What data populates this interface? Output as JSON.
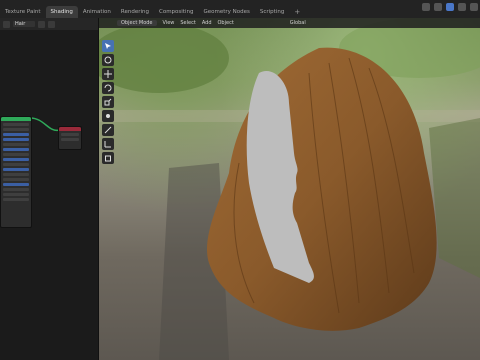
{
  "topbar": {
    "tabs": [
      "Texture Paint",
      "Shading",
      "Animation",
      "Rendering",
      "Compositing",
      "Geometry Nodes",
      "Scripting",
      "+"
    ],
    "active_tab": "Shading"
  },
  "left_panel": {
    "header_field": "Hair"
  },
  "viewport": {
    "mode": "Object Mode",
    "menu": [
      "View",
      "Select",
      "Add",
      "Object"
    ],
    "transform": "Global"
  },
  "colors": {
    "accent": "#4772b3",
    "hair": "#8a5a2b",
    "skin": "#bdbdbd"
  }
}
